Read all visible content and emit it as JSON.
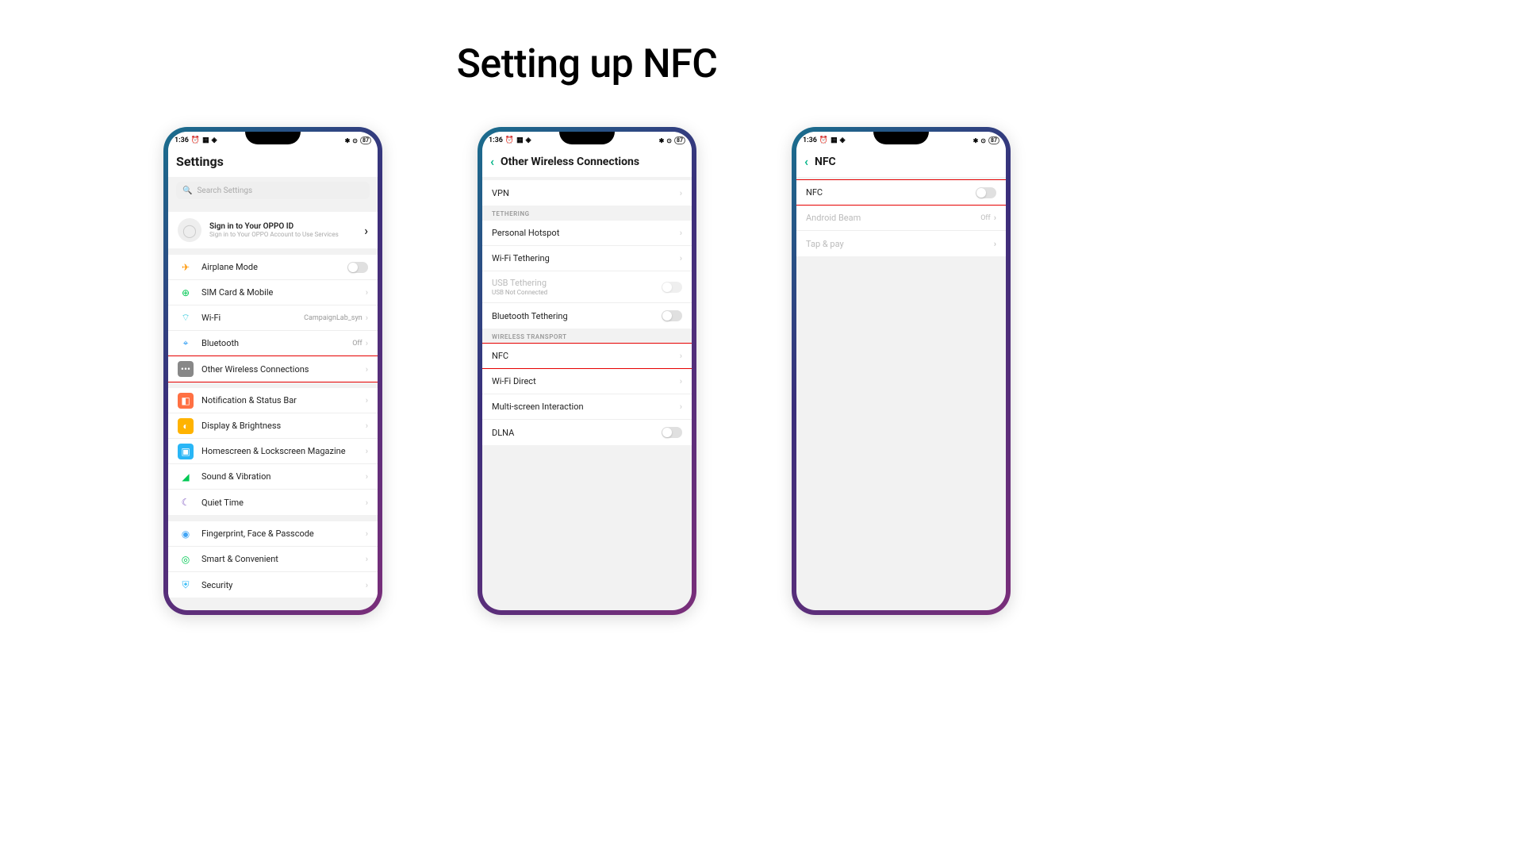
{
  "page_title": "Setting up NFC",
  "status": {
    "time": "1:36",
    "battery": "87"
  },
  "phone1": {
    "title": "Settings",
    "search_placeholder": "Search Settings",
    "signin_title": "Sign in to Your OPPO ID",
    "signin_sub": "Sign in to Your OPPO Account to Use Services",
    "rows": {
      "airplane": "Airplane Mode",
      "sim": "SIM Card & Mobile",
      "wifi": "Wi-Fi",
      "wifi_val": "CampaignLab_syn",
      "bt": "Bluetooth",
      "bt_val": "Off",
      "owc": "Other Wireless Connections",
      "notif": "Notification & Status Bar",
      "disp": "Display & Brightness",
      "home": "Homescreen & Lockscreen Magazine",
      "sound": "Sound & Vibration",
      "quiet": "Quiet Time",
      "finger": "Fingerprint, Face & Passcode",
      "smart": "Smart & Convenient",
      "security": "Security"
    }
  },
  "phone2": {
    "title": "Other Wireless Connections",
    "vpn": "VPN",
    "tethering_header": "Tethering",
    "hotspot": "Personal Hotspot",
    "wifiteth": "Wi-Fi Tethering",
    "usbteth": "USB Tethering",
    "usbteth_sub": "USB Not Connected",
    "btteth": "Bluetooth Tethering",
    "wireless_header": "Wireless Transport",
    "nfc": "NFC",
    "wfd": "Wi-Fi Direct",
    "msi": "Multi-screen Interaction",
    "dlna": "DLNA"
  },
  "phone3": {
    "title": "NFC",
    "nfc": "NFC",
    "beam": "Android Beam",
    "beam_val": "Off",
    "tap": "Tap & pay"
  }
}
